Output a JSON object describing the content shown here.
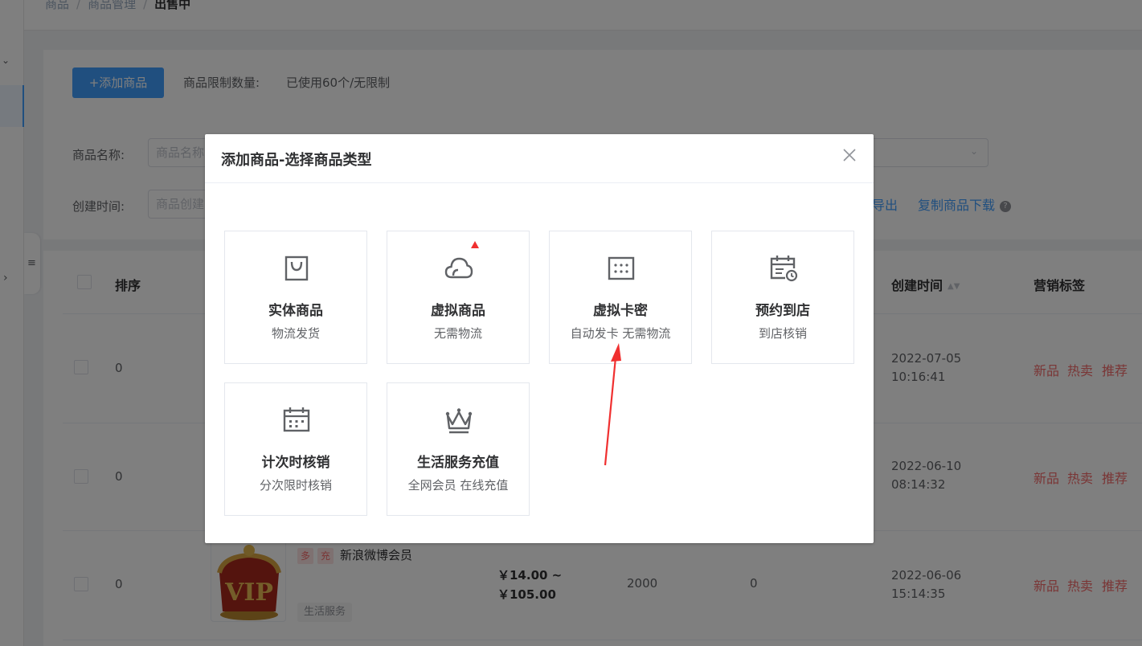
{
  "breadcrumb": [
    "商品",
    "商品管理",
    "出售中"
  ],
  "toolbar": {
    "add_button": "+添加商品",
    "limit_label": "商品限制数量:",
    "limit_value": "已使用60个/无限制"
  },
  "filters": {
    "name_label": "商品名称:",
    "name_placeholder": "商品名称",
    "time_label": "创建时间:",
    "time_placeholder": "商品创建",
    "export_link": "导出",
    "copy_download_link": "复制商品下载"
  },
  "table": {
    "headers": {
      "sort": "排序",
      "created": "创建时间",
      "marketing": "营销标签"
    },
    "rows": [
      {
        "sort": "0",
        "created_date": "2022-07-05",
        "created_time": "10:16:41",
        "tags": [
          "新品",
          "热卖",
          "推荐"
        ]
      },
      {
        "sort": "0",
        "created_date": "2022-06-10",
        "created_time": "08:14:32",
        "tags": [
          "新品",
          "热卖",
          "推荐"
        ]
      },
      {
        "sort": "0",
        "badges": [
          "多",
          "充"
        ],
        "title": "新浪微博会员",
        "category": "生活服务",
        "price_low": "￥14.00 ~",
        "price_high": "￥105.00",
        "stock": "2000",
        "sales": "0",
        "created_date": "2022-06-06",
        "created_time": "15:14:35",
        "tags": [
          "新品",
          "热卖",
          "推荐"
        ]
      }
    ]
  },
  "dialog": {
    "title": "添加商品-选择商品类型",
    "types": [
      {
        "icon": "shopping-bag-icon",
        "name": "实体商品",
        "desc": "物流发货"
      },
      {
        "icon": "cloud-icon",
        "name": "虚拟商品",
        "desc": "无需物流"
      },
      {
        "icon": "card-secret-icon",
        "name": "虚拟卡密",
        "desc": "自动发卡 无需物流"
      },
      {
        "icon": "calendar-clock-icon",
        "name": "预约到店",
        "desc": "到店核销"
      },
      {
        "icon": "calendar-icon",
        "name": "计次时核销",
        "desc": "分次限时核销"
      },
      {
        "icon": "crown-icon",
        "name": "生活服务充值",
        "desc": "全网会员 在线充值"
      }
    ]
  },
  "colors": {
    "primary": "#409eff",
    "danger": "#f56c6c",
    "annotation_red": "#f03030"
  }
}
